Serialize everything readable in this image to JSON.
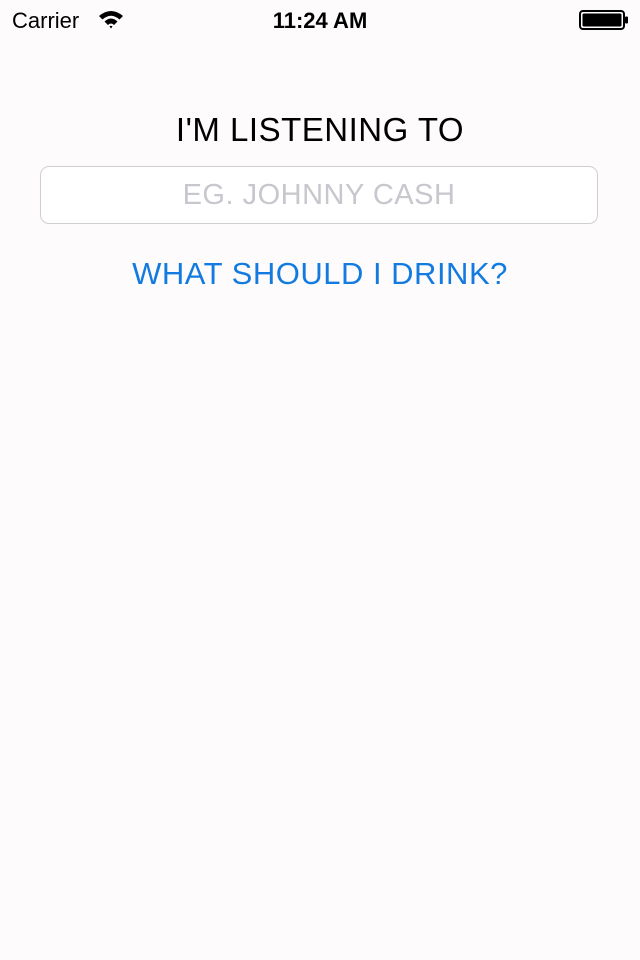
{
  "status_bar": {
    "carrier": "Carrier",
    "time": "11:24 AM",
    "wifi_icon": "wifi-icon",
    "battery_icon": "battery-icon"
  },
  "main": {
    "heading": "I'M LISTENING TO",
    "artist_input": {
      "value": "",
      "placeholder": "EG. JOHNNY CASH"
    },
    "drink_button_label": "WHAT SHOULD I DRINK?"
  },
  "colors": {
    "background": "#fdfbfc",
    "accent": "#137be0",
    "placeholder": "#c7c7cd",
    "text": "#000000"
  }
}
